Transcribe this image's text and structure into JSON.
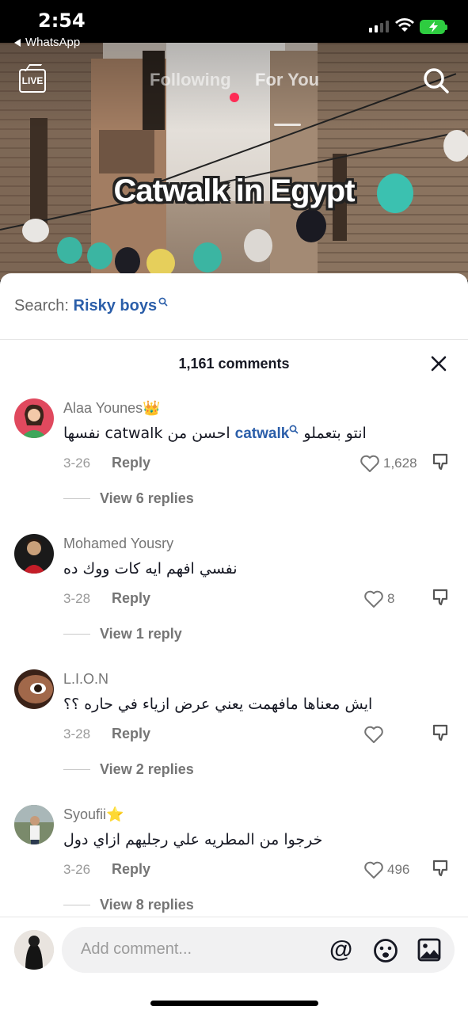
{
  "status_bar": {
    "time": "2:54",
    "back_app": "WhatsApp"
  },
  "top_nav": {
    "live_label": "LIVE",
    "tabs": [
      "Following",
      "For You"
    ],
    "active_tab": "For You"
  },
  "video": {
    "caption": "Catwalk in Egypt"
  },
  "search_suggestion": {
    "prefix": "Search:",
    "term": "Risky boys"
  },
  "comments_panel": {
    "count_label": "1,161 comments"
  },
  "comments": [
    {
      "username": "Alaa Younes👑",
      "text_before": "انتو بتعملو ",
      "mention": "catwalk",
      "text_after": " احسن من catwalk نفسها",
      "date": "3-26",
      "reply_label": "Reply",
      "likes": "1,628",
      "view_replies": "View 6 replies"
    },
    {
      "username": "Mohamed Yousry",
      "text": "نفسي افهم ايه كات ووك ده",
      "date": "3-28",
      "reply_label": "Reply",
      "likes": "8",
      "view_replies": "View 1 reply"
    },
    {
      "username": "L.I.O.N",
      "text": "ايش معناها مافهمت يعني عرض ازياء في حاره ؟؟",
      "date": "3-28",
      "reply_label": "Reply",
      "likes": "",
      "view_replies": "View 2 replies"
    },
    {
      "username": "Syoufii⭐",
      "text": "خرجوا من المطريه علي رجليهم ازاي دول",
      "date": "3-26",
      "reply_label": "Reply",
      "likes": "496",
      "view_replies": "View 8 replies"
    }
  ],
  "composer": {
    "placeholder": "Add comment...",
    "at_symbol": "@"
  },
  "colors": {
    "accent_blue": "#2b5ea9",
    "live_dot": "#fe2c55",
    "battery": "#2ecc40"
  }
}
